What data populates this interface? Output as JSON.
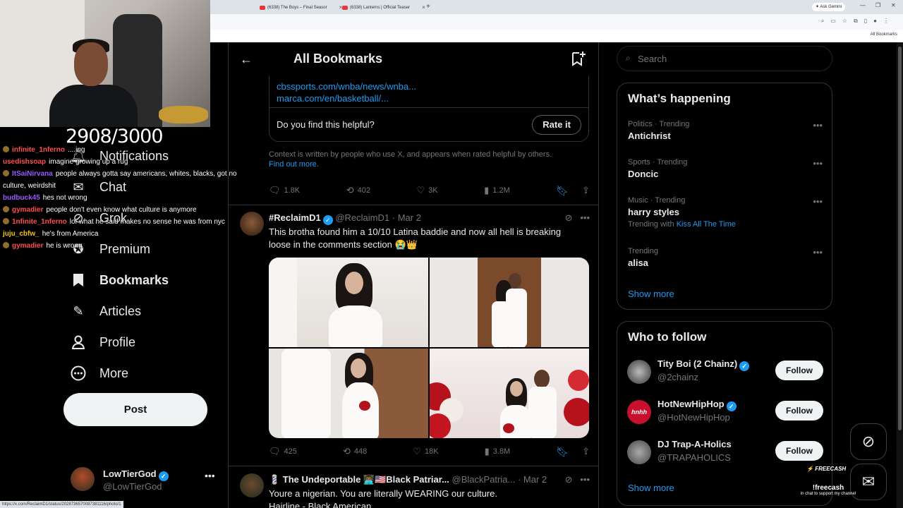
{
  "browser": {
    "tabs": [
      {
        "label": "(6338) The Boys – Final Seasor"
      },
      {
        "label": "(6338) Lanterns | Official Teaser"
      }
    ],
    "ask_gemini": "Ask Gemini",
    "bookmarks_bar_label": "All Bookmarks",
    "status_url": "https://x.com/ReclaimD1/status/2028736570087381116/photo/1"
  },
  "stream": {
    "goal": "2908/3000",
    "chat": [
      {
        "user": "infinite_1nferno",
        "color": "#ff4d4d",
        "text": "....ing"
      },
      {
        "user": "usedishsoap",
        "color": "#ff4d4d",
        "text": "imagine growing up a rug"
      },
      {
        "user": "ItSaiNirvana",
        "color": "#9b59ff",
        "text": "people always gotta say americans, whites, blacks, got no culture, weirdshit"
      },
      {
        "user": "budbuck45",
        "color": "#9b59ff",
        "text": "hes not wrong"
      },
      {
        "user": "gymadier",
        "color": "#ff4d4d",
        "text": "people don't even know what culture is anymore"
      },
      {
        "user": "1nfinite_1nferno",
        "color": "#ff4d4d",
        "text": "lol what he said makes no sense he was from nyc"
      },
      {
        "user": "juju_cbfw_",
        "color": "#f1c40f",
        "text": "he's from America"
      },
      {
        "user": "gymadier",
        "color": "#ff4d4d",
        "text": "he is wrong"
      }
    ],
    "brand": "FREECASH",
    "cta_command": "!freecash",
    "cta_message": "in chat to support my channel"
  },
  "nav": {
    "items": [
      {
        "label": "Notifications",
        "icon": "bell-icon"
      },
      {
        "label": "Chat",
        "icon": "chat-icon"
      },
      {
        "label": "Grok",
        "icon": "grok-icon"
      },
      {
        "label": "Premium",
        "icon": "premium-icon"
      },
      {
        "label": "Bookmarks",
        "icon": "bookmark-icon"
      },
      {
        "label": "Articles",
        "icon": "articles-icon"
      },
      {
        "label": "Profile",
        "icon": "profile-icon"
      },
      {
        "label": "More",
        "icon": "more-icon"
      }
    ],
    "post_label": "Post",
    "account": {
      "name": "LowTierGod",
      "handle": "@LowTierGod"
    }
  },
  "main": {
    "title": "All Bookmarks",
    "note_links": [
      "cbssports.com/wnba/news/wnba...",
      "marca.com/en/basketball/..."
    ],
    "note_question": "Do you find this helpful?",
    "rate_label": "Rate it",
    "context_text": "Context is written by people who use X, and appears when rated helpful by others.",
    "find_out_more": "Find out more.",
    "tweet0_stats": {
      "replies": "1.8K",
      "reposts": "402",
      "likes": "3K",
      "views": "1.2M"
    },
    "tweet1": {
      "name": "#ReclaimD1",
      "handle": "@ReclaimD1",
      "date": "· Mar 2",
      "text": "This brotha found him a 10/10 Latina baddie and now all hell is breaking loose in the comments section 😭👑",
      "stats": {
        "replies": "425",
        "reposts": "448",
        "likes": "18K",
        "views": "3.8M"
      }
    },
    "tweet2": {
      "name": "💈 The Undeportable 👨🏾‍💻🇺🇸Black Patriar...",
      "handle": "@BlackPatria...",
      "date": "· Mar 2",
      "text": "Youre a nigerian. You are literally WEARING our culture.",
      "text2": "Hairline - Black American"
    }
  },
  "sidebar": {
    "search_placeholder": "Search",
    "happening_title": "What’s happening",
    "trends": [
      {
        "context": "Politics · Trending",
        "title": "Antichrist"
      },
      {
        "context": "Sports · Trending",
        "title": "Doncic"
      },
      {
        "context": "Music · Trending",
        "title": "harry styles",
        "sub_prefix": "Trending with",
        "sub_keyword": "Kiss All The Time"
      },
      {
        "context": "Trending",
        "title": "alisa"
      }
    ],
    "show_more": "Show more",
    "wtf_title": "Who to follow",
    "follow": [
      {
        "name": "Tity Boi (2 Chainz)",
        "handle": "@2chainz"
      },
      {
        "name": "HotNewHipHop",
        "handle": "@HotNewHipHop",
        "avatar_text": "hnhh"
      },
      {
        "name": "DJ Trap-A-Holics",
        "handle": "@TRAPAHOLICS"
      }
    ],
    "follow_label": "Follow",
    "show_more_2": "Show more"
  },
  "colors": {
    "accent": "#1d9bf0",
    "background": "#000000",
    "border": "#2f3336",
    "muted": "#71767b"
  }
}
